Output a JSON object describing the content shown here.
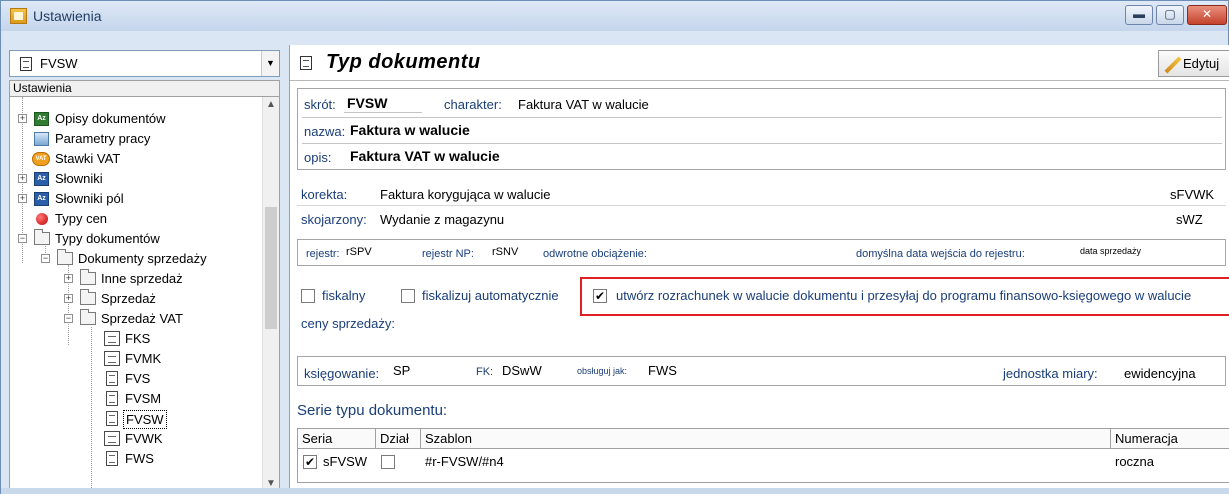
{
  "window": {
    "title": "Ustawienia",
    "min": "▬",
    "max": "▢",
    "close": "✕"
  },
  "left": {
    "combo_value": "FVSW",
    "combo_arrow": "▼",
    "tree_header": "Ustawienia",
    "scroll_up": "▲",
    "scroll_down": "▼",
    "items": [
      {
        "label": "Opisy dokumentów",
        "expander": "+"
      },
      {
        "label": "Parametry pracy"
      },
      {
        "label": "Stawki VAT",
        "icon_text": "VAT"
      },
      {
        "label": "Słowniki",
        "expander": "+"
      },
      {
        "label": "Słowniki pól",
        "expander": "+"
      },
      {
        "label": "Typy cen"
      },
      {
        "label": "Typy dokumentów",
        "expander": "−"
      },
      {
        "label": "Dokumenty sprzedaży",
        "expander": "−"
      },
      {
        "label": "Inne sprzedaż",
        "expander": "+"
      },
      {
        "label": "Sprzedaż",
        "expander": "+"
      },
      {
        "label": "Sprzedaż VAT",
        "expander": "−"
      },
      {
        "label": "FKS"
      },
      {
        "label": "FVMK"
      },
      {
        "label": "FVS"
      },
      {
        "label": "FVSM"
      },
      {
        "label": "FVSW"
      },
      {
        "label": "FVWK"
      },
      {
        "label": "FWS"
      }
    ]
  },
  "right": {
    "title": "Typ dokumentu",
    "edit_label": "Edytuj",
    "skrot_label": "skrót:",
    "skrot_value": "FVSW",
    "charakter_label": "charakter:",
    "charakter_value": "Faktura VAT w walucie",
    "nazwa_label": "nazwa:",
    "nazwa_value": "Faktura w walucie",
    "opis_label": "opis:",
    "opis_value": "Faktura VAT w walucie",
    "korekta_label": "korekta:",
    "korekta_value": "Faktura korygująca w walucie",
    "korekta_code": "sFVWK",
    "skojarzony_label": "skojarzony:",
    "skojarzony_value": "Wydanie z magazynu",
    "skojarzony_code": "sWZ",
    "rejestr_label": "rejestr:",
    "rejestr_value": "rSPV",
    "rejestr_np_label": "rejestr NP:",
    "rejestr_np_value": "rSNV",
    "odwrotne_label": "odwrotne obciążenie:",
    "domyslna_label": "domyślna data wejścia do rejestru:",
    "domyslna_value": "data sprzedaży",
    "fiskalny_label": "fiskalny",
    "fiskalizuj_label": "fiskalizuj automatycznie",
    "rozrachunek_label": "utwórz rozrachunek w walucie dokumentu i przesyłaj do programu finansowo-księgowego w walucie",
    "rozrachunek_check": "✔",
    "ceny_label": "ceny sprzedaży:",
    "ksiegowanie_label": "księgowanie:",
    "ksiegowanie_value": "SP",
    "fk_label": "FK:",
    "fk_value": "DSwW",
    "obsluguj_label": "obsługuj jak:",
    "obsluguj_value": "FWS",
    "jednostka_label": "jednostka miary:",
    "jednostka_value": "ewidencyjna",
    "serie_title": "Serie typu dokumentu:",
    "grid_headers": [
      "Seria",
      "Dział",
      "Szablon",
      "Numeracja"
    ],
    "grid_row": {
      "check": "✔",
      "seria": "sFVSW",
      "szablon": "#r-FVSW/#n4",
      "numeracja": "roczna"
    }
  }
}
